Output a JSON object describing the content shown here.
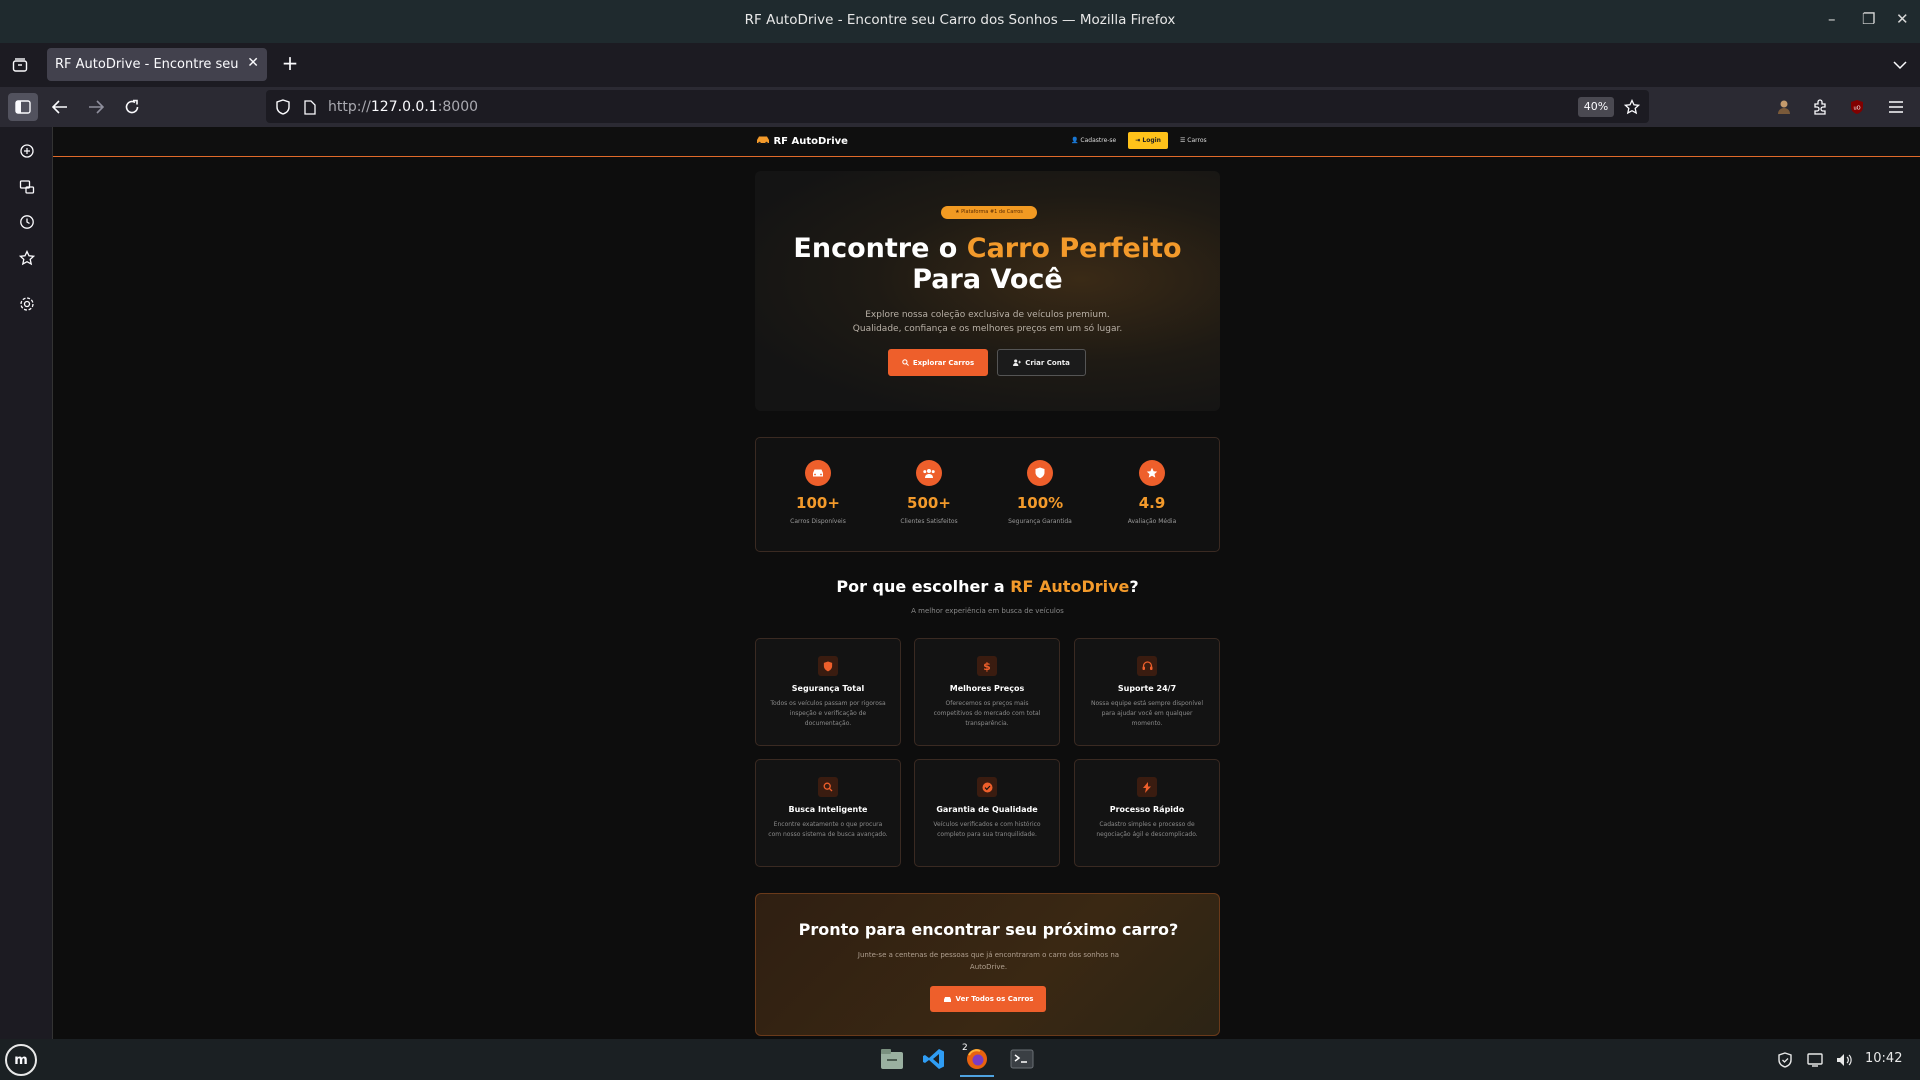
{
  "window": {
    "title": "RF AutoDrive - Encontre seu Carro dos Sonhos — Mozilla Firefox"
  },
  "tab": {
    "label": "RF AutoDrive - Encontre seu Carro dos Sonhos"
  },
  "urlbar": {
    "url_prefix": "http://",
    "url_host": "127.0.0.1",
    "url_port": ":8000",
    "zoom": "40%"
  },
  "site": {
    "logo": "RF AutoDrive",
    "nav": {
      "signup": "Cadastre-se",
      "login": "Login",
      "cars": "Carros"
    },
    "hero": {
      "badge": "Plataforma #1 de Carros",
      "title_part1": "Encontre o ",
      "title_highlight": "Carro Perfeito",
      "title_part2": "Para Você",
      "subtitle_line1": "Explore nossa coleção exclusiva de veículos premium.",
      "subtitle_line2": "Qualidade, confiança e os melhores preços em um só lugar.",
      "btn_explore": "Explorar Carros",
      "btn_create": "Criar Conta"
    },
    "stats": [
      {
        "value": "100+",
        "label": "Carros Disponíveis",
        "icon": "car-icon"
      },
      {
        "value": "500+",
        "label": "Clientes Satisfeitos",
        "icon": "users-icon"
      },
      {
        "value": "100%",
        "label": "Segurança Garantida",
        "icon": "shield-icon"
      },
      {
        "value": "4.9",
        "label": "Avaliação Média",
        "icon": "star-icon"
      }
    ],
    "why": {
      "title_part1": "Por que escolher a ",
      "title_highlight": "RF AutoDrive",
      "title_part2": "?",
      "subtitle": "A melhor experiência em busca de veículos"
    },
    "features": [
      {
        "title": "Segurança Total",
        "desc": "Todos os veículos passam por rigorosa inspeção e verificação de documentação.",
        "icon": "shield-icon"
      },
      {
        "title": "Melhores Preços",
        "desc": "Oferecemos os preços mais competitivos do mercado com total transparência.",
        "icon": "dollar-icon"
      },
      {
        "title": "Suporte 24/7",
        "desc": "Nossa equipe está sempre disponível para ajudar você em qualquer momento.",
        "icon": "headset-icon"
      },
      {
        "title": "Busca Inteligente",
        "desc": "Encontre exatamente o que procura com nosso sistema de busca avançado.",
        "icon": "search-icon"
      },
      {
        "title": "Garantia de Qualidade",
        "desc": "Veículos verificados e com histórico completo para sua tranquilidade.",
        "icon": "check-badge-icon"
      },
      {
        "title": "Processo Rápido",
        "desc": "Cadastro simples e processo de negociação ágil e descomplicado.",
        "icon": "bolt-icon"
      }
    ],
    "cta": {
      "title": "Pronto para encontrar seu próximo carro?",
      "text": "Junte-se a centenas de pessoas que já encontraram o carro dos sonhos na AutoDrive.",
      "button": "Ver Todos os Carros"
    }
  },
  "taskbar": {
    "firefox_badge": "2",
    "clock": "10:42"
  },
  "colors": {
    "accent": "#ee5f2b",
    "highlight": "#f39a2b",
    "login": "#ffc21a"
  }
}
